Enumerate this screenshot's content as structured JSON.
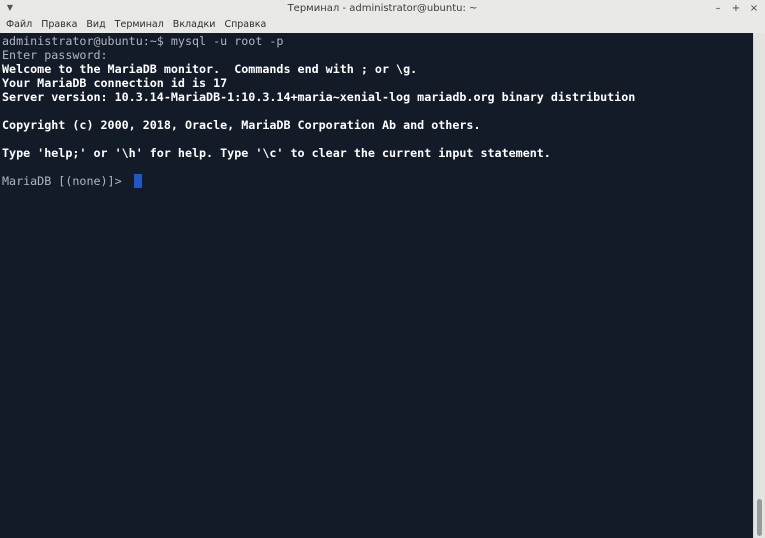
{
  "window": {
    "title": "Терминал - administrator@ubuntu: ~",
    "controls": {
      "minimize": "–",
      "maximize": "+",
      "close": "×"
    }
  },
  "menubar": {
    "items": [
      {
        "label": "Файл"
      },
      {
        "label": "Правка"
      },
      {
        "label": "Вид"
      },
      {
        "label": "Терминал"
      },
      {
        "label": "Вкладки"
      },
      {
        "label": "Справка"
      }
    ]
  },
  "terminal": {
    "lines": [
      {
        "text": "administrator@ubuntu:~$ mysql -u root -p"
      },
      {
        "text": "Enter password:"
      },
      {
        "text": "Welcome to the MariaDB monitor.  Commands end with ; or \\g."
      },
      {
        "text": "Your MariaDB connection id is 17"
      },
      {
        "text": "Server version: 10.3.14-MariaDB-1:10.3.14+maria~xenial-log mariadb.org binary distribution"
      },
      {
        "text": ""
      },
      {
        "text": "Copyright (c) 2000, 2018, Oracle, MariaDB Corporation Ab and others."
      },
      {
        "text": ""
      },
      {
        "text": "Type 'help;' or '\\h' for help. Type '\\c' to clear the current input statement."
      },
      {
        "text": ""
      },
      {
        "text": "MariaDB [(none)]> "
      }
    ]
  },
  "colors": {
    "terminal_bg": "#141b28",
    "dim_text": "#aeb5c0",
    "bright_text": "#ffffff",
    "cursor": "#1f57c7"
  }
}
